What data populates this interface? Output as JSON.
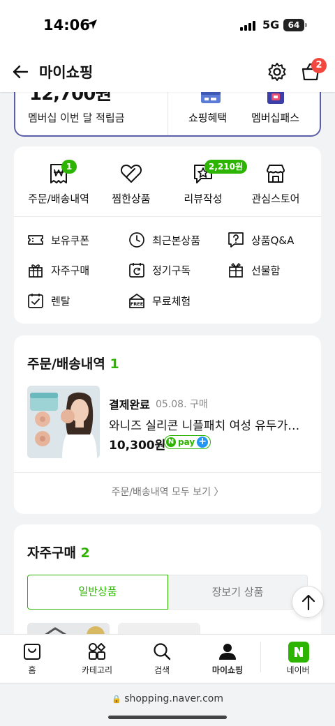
{
  "status": {
    "time": "14:06",
    "network": "5G",
    "battery": "64"
  },
  "header": {
    "title": "마이쇼핑",
    "cart_count": "2"
  },
  "membership": {
    "amount": "12,700원",
    "label": "멤버십 이번 달 적립금",
    "benefit_label": "쇼핑혜택",
    "pass_label": "멤버십패스"
  },
  "shortcuts": {
    "main": [
      {
        "label": "주문/배송내역",
        "icon": "receipt-won-icon",
        "badge": "1"
      },
      {
        "label": "찜한상품",
        "icon": "heart-icon",
        "badge": ""
      },
      {
        "label": "리뷰작성",
        "icon": "review-star-icon",
        "badge": "2,210원"
      },
      {
        "label": "관심스토어",
        "icon": "store-icon",
        "badge": ""
      }
    ],
    "sub": [
      {
        "label": "보유쿠폰",
        "icon": "coupon-icon"
      },
      {
        "label": "최근본상품",
        "icon": "clock-icon"
      },
      {
        "label": "상품Q&A",
        "icon": "question-chat-icon"
      },
      {
        "label": "자주구매",
        "icon": "gift-box-icon"
      },
      {
        "label": "정기구독",
        "icon": "calendar-repeat-icon"
      },
      {
        "label": "선물함",
        "icon": "present-icon"
      },
      {
        "label": "렌탈",
        "icon": "calendar-check-icon"
      },
      {
        "label": "무료체험",
        "icon": "free-tag-icon"
      }
    ]
  },
  "orders": {
    "title": "주문/배송내역",
    "count": "1",
    "item": {
      "status": "결제완료",
      "date": "05.08. 구매",
      "name": "와니즈 실리콘 니플패치 여성 유두가…",
      "price": "10,300원",
      "pay_label": "pay"
    },
    "view_all": "주문/배송내역 모두 보기 〉"
  },
  "frequent": {
    "title": "자주구매",
    "count": "2",
    "tabs": [
      "일반상품",
      "장보기 상품"
    ]
  },
  "nav": [
    {
      "label": "홈",
      "icon": "shopping-bag-icon"
    },
    {
      "label": "카테고리",
      "icon": "category-grid-icon"
    },
    {
      "label": "검색",
      "icon": "search-icon"
    },
    {
      "label": "마이쇼핑",
      "icon": "person-icon"
    },
    {
      "label": "네이버",
      "icon": "naver-n-icon"
    }
  ],
  "url": "shopping.naver.com",
  "colors": {
    "accent": "#2db400",
    "member_border": "#5b5ea8",
    "badge_red": "#f2473f"
  }
}
